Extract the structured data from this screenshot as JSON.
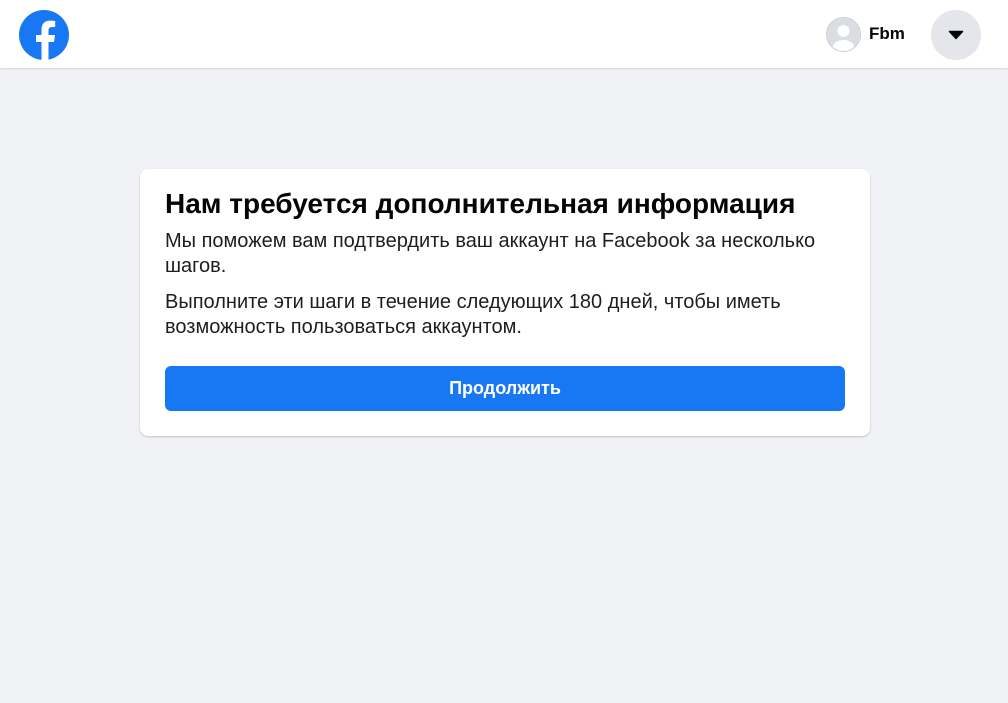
{
  "header": {
    "logo_icon": "facebook-logo-icon",
    "brand_color": "#1877f2",
    "profile_name": "Fbm",
    "avatar_icon": "default-avatar-icon",
    "menu_icon": "caret-down-icon"
  },
  "card": {
    "title": "Нам требуется дополнительная информация",
    "paragraph_1": "Мы поможем вам подтвердить ваш аккаунт на Facebook за несколько шагов.",
    "paragraph_2": "Выполните эти шаги в течение следующих 180 дней, чтобы иметь возможность пользоваться аккаунтом.",
    "continue_label": "Продолжить"
  }
}
